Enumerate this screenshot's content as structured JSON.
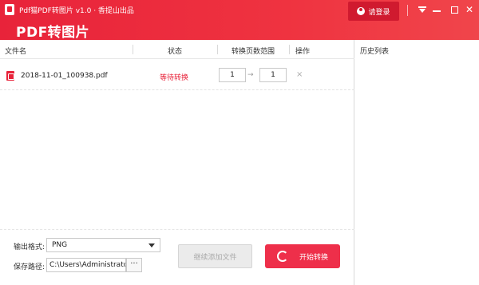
{
  "titlebar": {
    "app_title": "Pdf猫PDF转图片 v1.0 · 香提山出品",
    "main_title": "PDF转图片",
    "login_label": "请登录",
    "menu_icon": "menu-dropdown-icon",
    "minimize_icon": "minimize-icon",
    "maximize_icon": "maximize-icon",
    "close_icon": "close-icon",
    "accent_color": "#e8233a"
  },
  "table": {
    "columns": [
      "文件名",
      "状态",
      "转换页数范围",
      "操作"
    ],
    "rows": [
      {
        "file_name": "2018-11-01_100938.pdf",
        "status": "等待转换",
        "page_from": "1",
        "arrow": "→",
        "page_to": "1",
        "action": "×",
        "icon": "pdf-file-icon"
      }
    ]
  },
  "output": {
    "format_label": "输出格式:",
    "format_value": "PNG",
    "path_label": "保存路径:",
    "path_value": "C:\\Users\\Administrator",
    "browse_label": "···"
  },
  "buttons": {
    "add_files": "继续添加文件",
    "start_convert": "开始转换"
  },
  "history": {
    "title": "历史列表"
  }
}
